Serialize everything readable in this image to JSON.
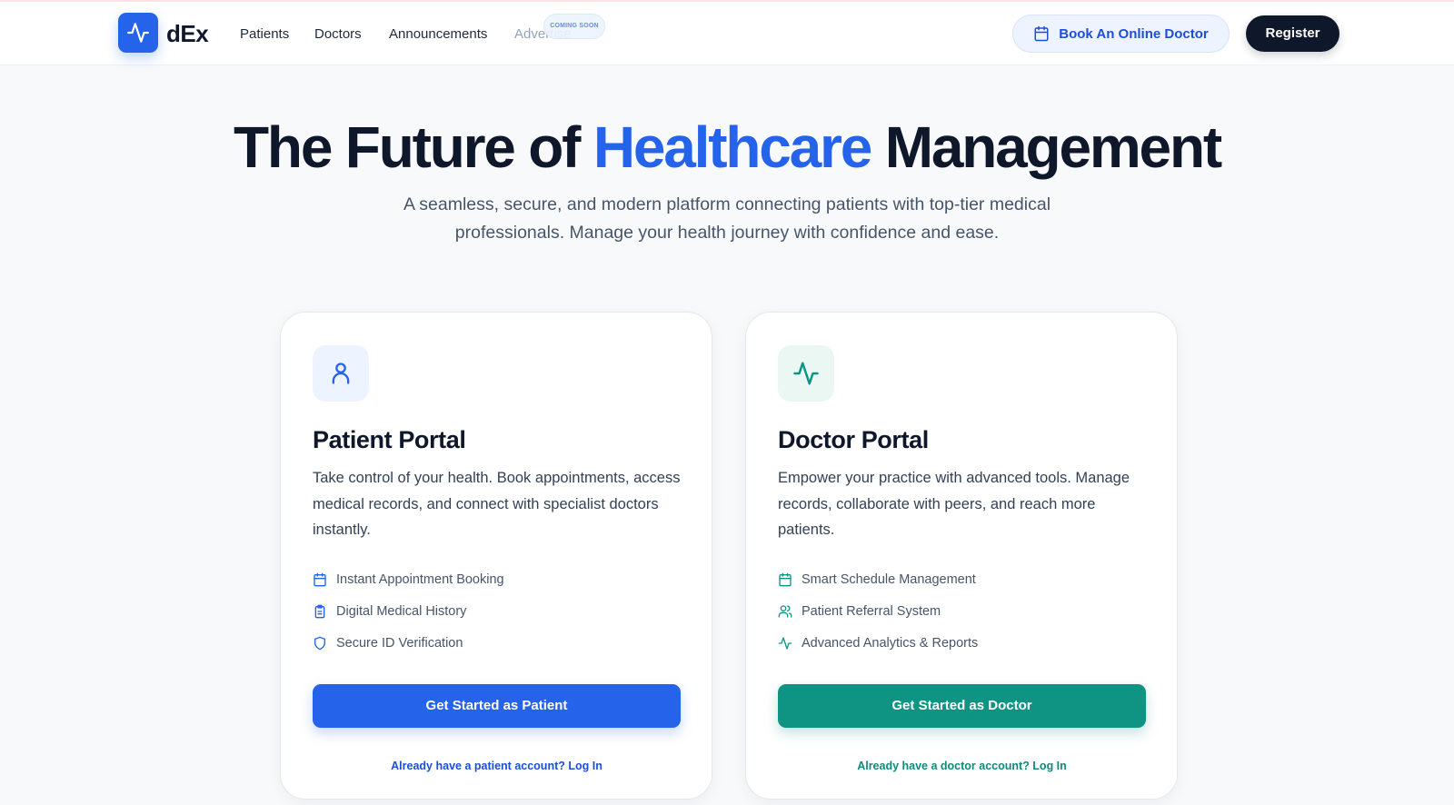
{
  "brand": {
    "name": "dEx",
    "icon": "activity-pulse-icon",
    "color": "#2563eb"
  },
  "nav": {
    "links": [
      {
        "label": "Patients"
      },
      {
        "label": "Doctors"
      },
      {
        "label": "Announcements"
      },
      {
        "label": "Advertise",
        "badge": "COMING SOON",
        "disabled": true
      }
    ],
    "book_button": {
      "label": "Book An Online Doctor",
      "icon": "calendar-icon"
    },
    "register_button": {
      "label": "Register"
    }
  },
  "hero": {
    "title_before": "The Future of",
    "title_accent": "Healthcare",
    "title_after": "Management",
    "subtitle": "A seamless, secure, and modern platform connecting patients with top-tier medical professionals. Manage your health journey with confidence and ease."
  },
  "patient_card": {
    "icon": "user-icon",
    "title": "Patient Portal",
    "description": "Take control of your health. Book appointments, access medical records, and connect with specialist doctors instantly.",
    "features": [
      {
        "icon": "calendar-icon",
        "label": "Instant Appointment Booking"
      },
      {
        "icon": "clipboard-icon",
        "label": "Digital Medical History"
      },
      {
        "icon": "shield-icon",
        "label": "Secure ID Verification"
      }
    ],
    "cta": "Get Started as Patient",
    "login_link": "Already have a patient account? Log In",
    "accent": "#2563eb"
  },
  "doctor_card": {
    "icon": "activity-icon",
    "title": "Doctor Portal",
    "description": "Empower your practice with advanced tools. Manage records, collaborate with peers, and reach more patients.",
    "features": [
      {
        "icon": "calendar-icon",
        "label": "Smart Schedule Management"
      },
      {
        "icon": "users-icon",
        "label": "Patient Referral System"
      },
      {
        "icon": "activity-icon",
        "label": "Advanced Analytics & Reports"
      }
    ],
    "cta": "Get Started as Doctor",
    "login_link": "Already have a doctor account? Log In",
    "accent": "#0f9484"
  }
}
